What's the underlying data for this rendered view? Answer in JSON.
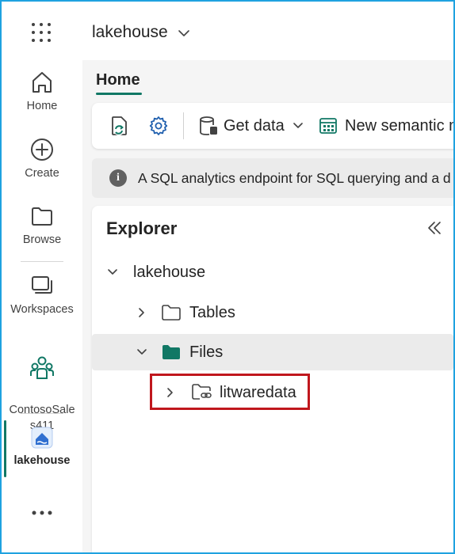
{
  "header": {
    "app_menu_icon": "waffle-icon",
    "workspace_item": "lakehouse",
    "dropdown_icon": "chevron-down-icon"
  },
  "rail": {
    "items": [
      {
        "label": "Home",
        "icon": "home-icon"
      },
      {
        "label": "Create",
        "icon": "create-plus-icon"
      },
      {
        "label": "Browse",
        "icon": "folder-icon"
      },
      {
        "label": "Workspaces",
        "icon": "workspaces-icon"
      },
      {
        "label": "ContosoSale\ns411",
        "icon": "people-icon"
      },
      {
        "label": "lakehouse",
        "icon": "lakehouse-icon"
      }
    ],
    "more_icon": "more-horizontal-icon",
    "accent_color": "#117865"
  },
  "main": {
    "tabs": [
      {
        "label": "Home"
      }
    ],
    "toolbar": {
      "refresh_icon": "refresh-icon",
      "settings_icon": "settings-gear-icon",
      "get_data_label": "Get data",
      "new_semantic_label": "New semantic m"
    },
    "info_text": "A SQL analytics endpoint for SQL querying and a d",
    "explorer": {
      "title": "Explorer",
      "tree": {
        "root": "lakehouse",
        "tables": "Tables",
        "files": "Files",
        "child": "litwaredata"
      }
    }
  },
  "colors": {
    "frame_border": "#1fa2e0",
    "highlight_box": "#c0171d",
    "folder_filled": "#117865"
  }
}
